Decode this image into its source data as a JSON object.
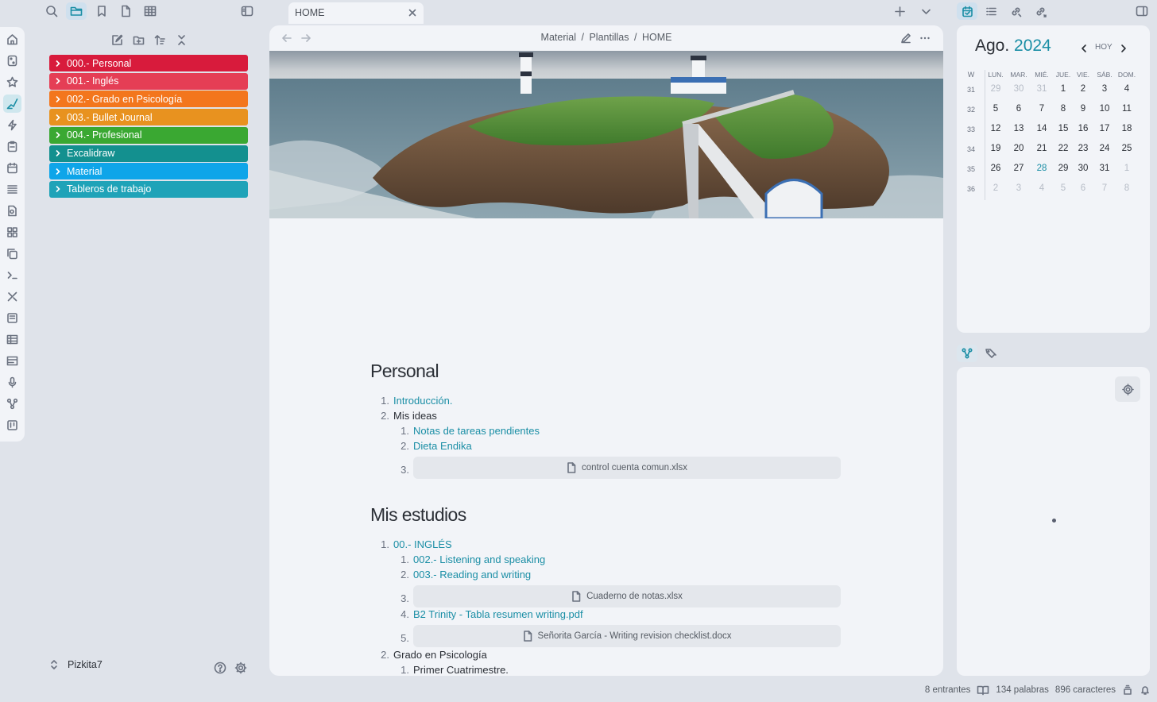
{
  "tab": {
    "title": "HOME"
  },
  "breadcrumb": {
    "p1": "Material",
    "p2": "Plantillas",
    "p3": "HOME",
    "sep": "/"
  },
  "explorer": {
    "folders": [
      {
        "label": "000.- Personal",
        "color": "#d81b3c"
      },
      {
        "label": "001.- Inglés",
        "color": "#e53e55"
      },
      {
        "label": "002.- Grado en Psicología",
        "color": "#f3761d"
      },
      {
        "label": "003.- Bullet Journal",
        "color": "#e8921f"
      },
      {
        "label": "004.- Profesional",
        "color": "#3aa832"
      },
      {
        "label": "Excalidraw",
        "color": "#13908f"
      },
      {
        "label": "Material",
        "color": "#0ea5e9"
      },
      {
        "label": "Tableros de trabajo",
        "color": "#1fa3b8"
      }
    ],
    "vault_name": "Pizkita7"
  },
  "doc": {
    "h1": "Personal",
    "p_item1": "Introducción.",
    "p_item2": "Mis ideas",
    "p_sub1": "Notas de tareas pendientes",
    "p_sub2": "Dieta Endika",
    "p_file": "control cuenta comun.xlsx",
    "h2": "Mis estudios",
    "e_item1": "00.- INGLÉS",
    "e_sub1": "002.- Listening and speaking",
    "e_sub2": "003.- Reading and writing",
    "e_file1": "Cuaderno de notas.xlsx",
    "e_sub4": "B2 Trinity - Tabla resumen writing.pdf",
    "e_file2": "Señorita García - Writing revision checklist.docx",
    "e_item2": "Grado en Psicología",
    "e_sub_cut": "Primer Cuatrimestre.",
    "n1": "1.",
    "n2": "2.",
    "n3": "3.",
    "n4": "4.",
    "n5": "5."
  },
  "calendar": {
    "month": "Ago.",
    "year": "2024",
    "today_label": "HOY",
    "week_col": "W",
    "days": [
      "LUN.",
      "MAR.",
      "MIÉ.",
      "JUE.",
      "VIE.",
      "SÁB.",
      "DOM."
    ],
    "weeks": [
      {
        "w": "31",
        "d": [
          "29",
          "30",
          "31",
          "1",
          "2",
          "3",
          "4"
        ],
        "dim": [
          0,
          1,
          2
        ]
      },
      {
        "w": "32",
        "d": [
          "5",
          "6",
          "7",
          "8",
          "9",
          "10",
          "11"
        ],
        "dim": []
      },
      {
        "w": "33",
        "d": [
          "12",
          "13",
          "14",
          "15",
          "16",
          "17",
          "18"
        ],
        "dim": []
      },
      {
        "w": "34",
        "d": [
          "19",
          "20",
          "21",
          "22",
          "23",
          "24",
          "25"
        ],
        "dim": []
      },
      {
        "w": "35",
        "d": [
          "26",
          "27",
          "28",
          "29",
          "30",
          "31",
          "1"
        ],
        "dim": [
          6
        ],
        "today": 2
      },
      {
        "w": "36",
        "d": [
          "2",
          "3",
          "4",
          "5",
          "6",
          "7",
          "8"
        ],
        "dim": [
          0,
          1,
          2,
          3,
          4,
          5,
          6
        ]
      }
    ]
  },
  "status": {
    "backlinks": "8 entrantes",
    "words": "134 palabras",
    "chars": "896 caracteres"
  }
}
